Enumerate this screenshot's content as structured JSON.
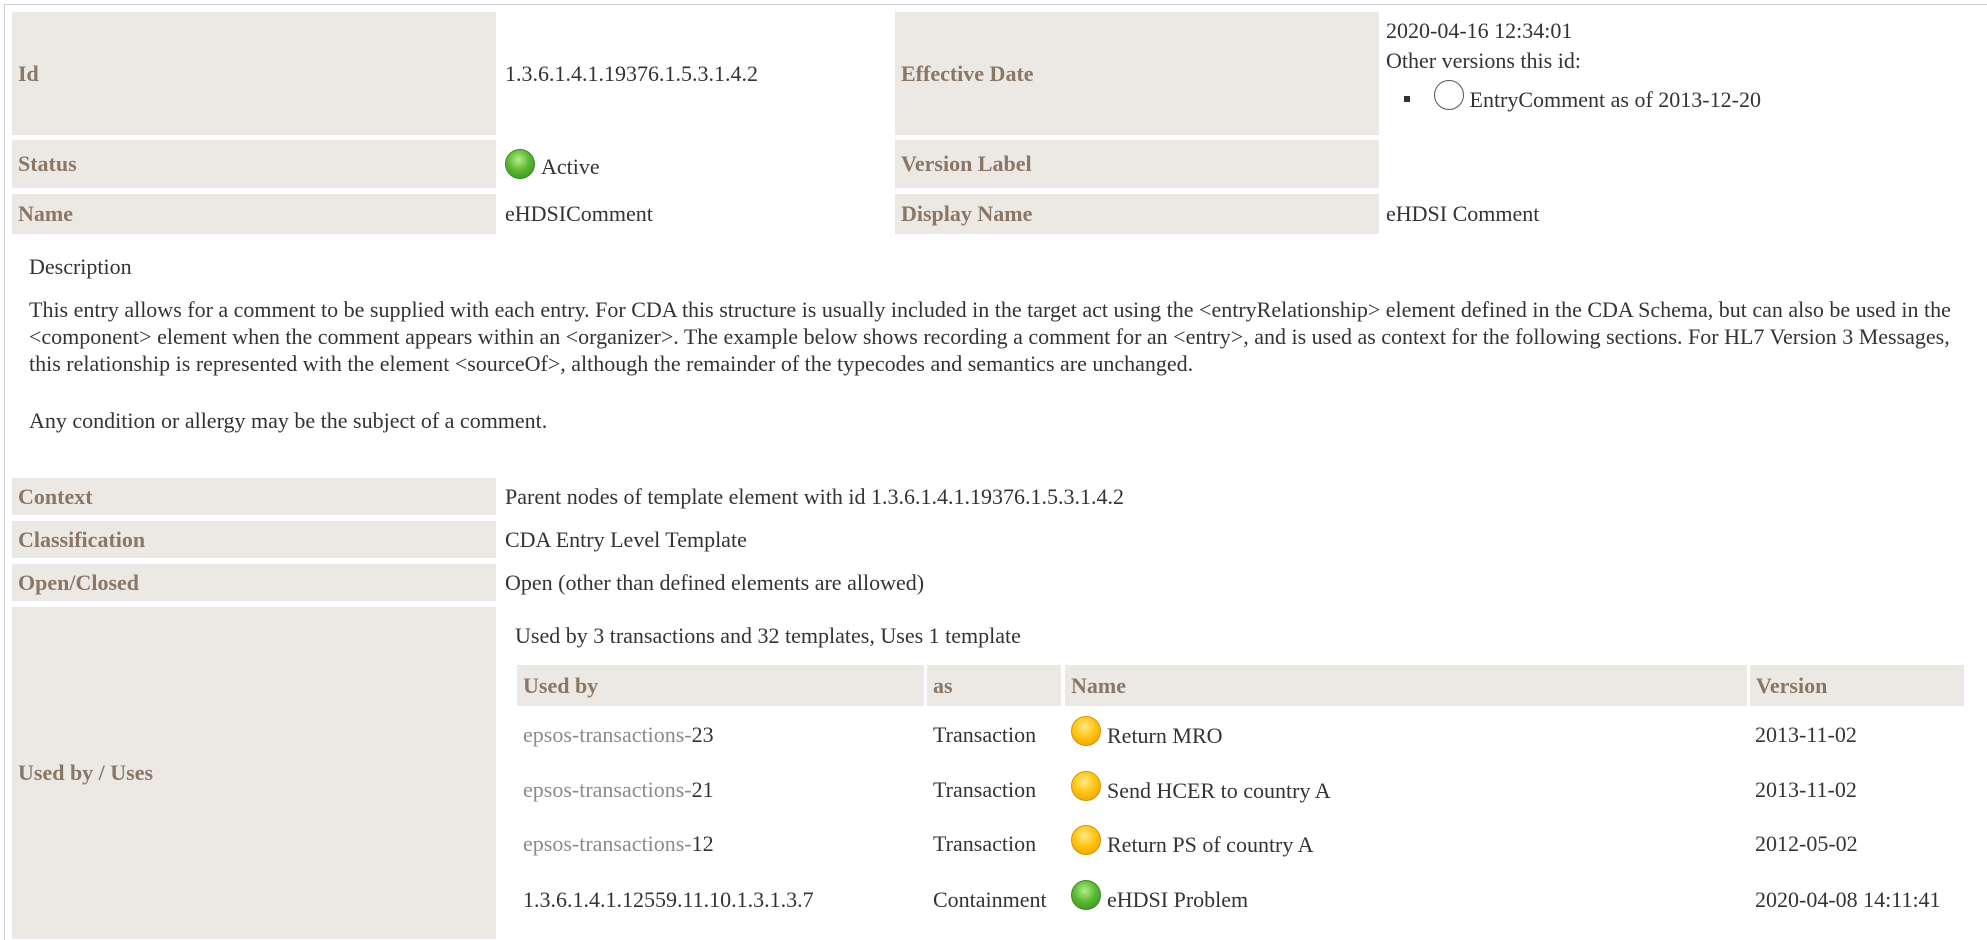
{
  "header": {
    "id_label": "Id",
    "id_value": "1.3.6.1.4.1.19376.1.5.3.1.4.2",
    "effective_label": "Effective Date",
    "effective_value": "2020-04-16 12:34:01",
    "other_versions_label": "Other versions this id:",
    "other_version_item": "EntryComment as of 2013-12-20",
    "status_label": "Status",
    "status_value": "Active",
    "version_label": "Version Label",
    "version_value": "",
    "name_label": "Name",
    "name_value": "eHDSIComment",
    "display_name_label": "Display Name",
    "display_name_value": "eHDSI Comment"
  },
  "description": {
    "heading": "Description",
    "paragraph1": "This entry allows for a comment to be supplied with each entry. For CDA this structure is usually included in the target act using the <entryRelationship> element defined in the CDA Schema, but can also be used in the <component> element when the comment appears within an <organizer>. The example below shows recording a comment for an <entry>, and is used as context for the following sections. For HL7 Version 3 Messages, this relationship is represented with the element <sourceOf>, although the remainder of the typecodes and semantics are unchanged.",
    "paragraph2": "Any condition or allergy may be the subject of a comment."
  },
  "properties": {
    "context_label": "Context",
    "context_value": "Parent nodes of template element with id 1.3.6.1.4.1.19376.1.5.3.1.4.2",
    "classification_label": "Classification",
    "classification_value": "CDA Entry Level Template",
    "open_closed_label": "Open/Closed",
    "open_closed_value": "Open (other than defined elements are allowed)",
    "used_by_label": "Used by / Uses"
  },
  "usage": {
    "summary": "Used by 3 transactions and 32 templates, Uses 1 template",
    "columns": [
      "Used by",
      "as",
      "Name",
      "Version"
    ],
    "rows": [
      {
        "prefix": "epsos-transactions-",
        "id": "23",
        "as": "Transaction",
        "name": "Return MRO",
        "version": "2013-11-02",
        "status_color": "#ffc414"
      },
      {
        "prefix": "epsos-transactions-",
        "id": "21",
        "as": "Transaction",
        "name": "Send HCER to country A",
        "version": "2013-11-02",
        "status_color": "#ffc414"
      },
      {
        "prefix": "epsos-transactions-",
        "id": "12",
        "as": "Transaction",
        "name": "Return PS of country A",
        "version": "2012-05-02",
        "status_color": "#ffc414"
      },
      {
        "prefix": "",
        "id": "1.3.6.1.4.1.12559.11.10.1.3.1.3.7",
        "as": "Containment",
        "name": "eHDSI Problem",
        "version": "2020-04-08 14:11:41",
        "status_color": "#5cb935"
      }
    ]
  },
  "colors": {
    "header_bg": "#ece9e5",
    "header_text": "#8a7766",
    "active_green": "#5cb935",
    "pending_yellow": "#ffc414"
  }
}
